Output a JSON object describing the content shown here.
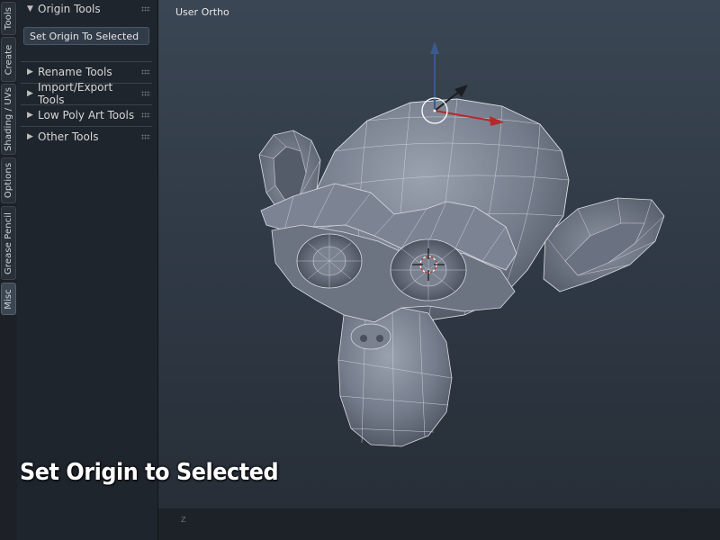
{
  "tabs": [
    {
      "label": "Tools",
      "active": false
    },
    {
      "label": "Create",
      "active": false
    },
    {
      "label": "Shading / UVs",
      "active": false
    },
    {
      "label": "Options",
      "active": false
    },
    {
      "label": "Grease Pencil",
      "active": false
    },
    {
      "label": "Misc",
      "active": true
    }
  ],
  "panel": {
    "origin_tools": {
      "label": "Origin Tools",
      "expanded": true,
      "button_label": "Set Origin To Selected"
    },
    "rename_tools": {
      "label": "Rename Tools",
      "expanded": false
    },
    "import_export_tools": {
      "label": "Import/Export Tools",
      "expanded": false
    },
    "low_poly_art_tools": {
      "label": "Low Poly Art Tools",
      "expanded": false
    },
    "other_tools": {
      "label": "Other Tools",
      "expanded": false
    }
  },
  "viewport": {
    "view_label": "User Ortho",
    "axis_label": "Z",
    "object": "monkey-mesh"
  },
  "caption": "Set Origin to Selected",
  "colors": {
    "gizmo_z": "#3b5a8c",
    "gizmo_x": "#b42a2a",
    "mesh": "#7c8494",
    "wire": "#d9dde3"
  }
}
